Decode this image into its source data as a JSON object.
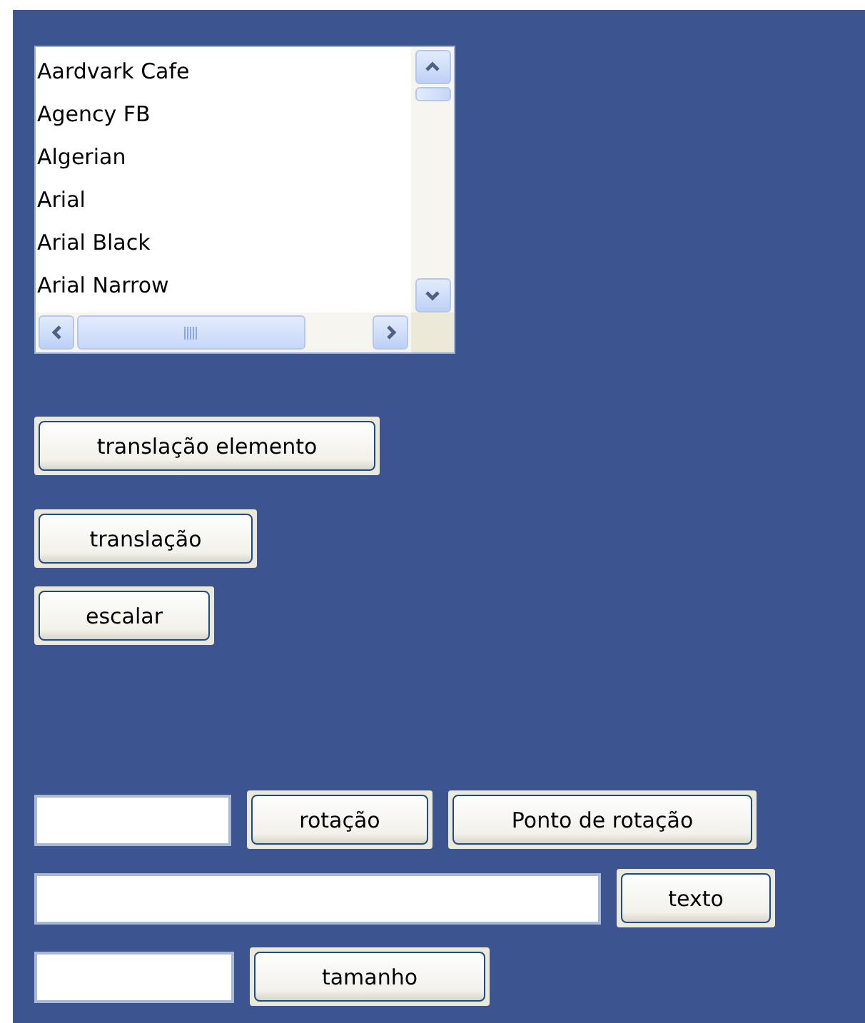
{
  "font_list": {
    "items": [
      {
        "label": "Aardvark Cafe",
        "selected": false
      },
      {
        "label": "Agency FB",
        "selected": false
      },
      {
        "label": "Algerian",
        "selected": false
      },
      {
        "label": "Arial",
        "selected": false
      },
      {
        "label": "Arial Black",
        "selected": false
      },
      {
        "label": "Arial Narrow",
        "selected": false
      }
    ]
  },
  "buttons": [
    "translação elemento",
    "translação",
    "escalar"
  ],
  "form_rows": [
    {
      "buttons": [
        "rotação",
        "Ponto de rotação"
      ]
    },
    {
      "buttons": [
        "texto"
      ]
    },
    {
      "buttons": [
        "tamanho"
      ]
    }
  ]
}
